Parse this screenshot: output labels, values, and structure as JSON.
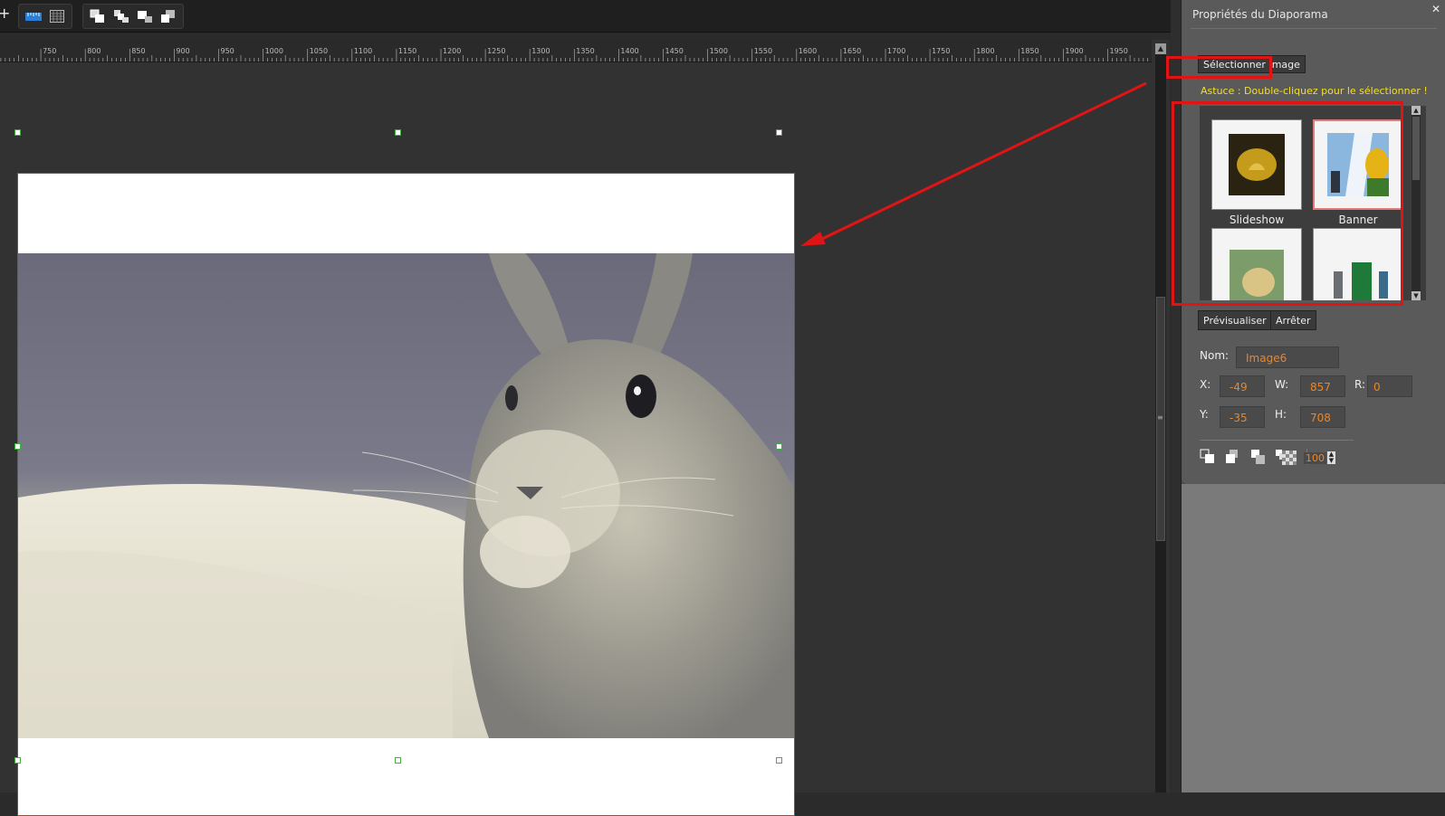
{
  "toolbar": {
    "plus_icon": "plus-icon",
    "view_icons": [
      "ruler-icon",
      "grid-icon"
    ],
    "arrange_icons": [
      "bring-to-front-icon",
      "bring-forward-icon",
      "send-backward-icon",
      "send-to-back-icon"
    ]
  },
  "ruler": {
    "labels": [
      "750",
      "800",
      "850",
      "900",
      "950",
      "1000",
      "1050",
      "1100",
      "1150",
      "1200",
      "1250",
      "1300",
      "1350",
      "1400",
      "1450",
      "1500",
      "1550",
      "1600",
      "1650",
      "1700",
      "1750",
      "1800",
      "1850",
      "1900",
      "1950"
    ]
  },
  "panel": {
    "title": "Propriétés du Diaporama",
    "close": "✕",
    "select_image_button": "Sélectionner Image",
    "hint": "Astuce : Double-cliquez pour le sélectionner !",
    "thumbnails": [
      {
        "label": "Slideshow",
        "icon": "slideshow-thumbnail"
      },
      {
        "label": "Banner",
        "icon": "banner-thumbnail"
      },
      {
        "label": "",
        "icon": "collage-thumbnail"
      },
      {
        "label": "",
        "icon": "carousel-thumbnail"
      }
    ],
    "preview_button": "Prévisualiser",
    "stop_button": "Arrêter",
    "name_label": "Nom:",
    "name_value": "Image6",
    "x_label": "X:",
    "x_value": "-49",
    "w_label": "W:",
    "w_value": "857",
    "r_label": "R:",
    "r_value": "0",
    "y_label": "Y:",
    "y_value": "-35",
    "h_label": "H:",
    "h_value": "708",
    "opacity_value": "100"
  },
  "colors": {
    "highlight_red": "#e01414",
    "hint_yellow": "#f3df2a",
    "value_orange": "#e8862a",
    "handle_green": "#3fb23f"
  }
}
